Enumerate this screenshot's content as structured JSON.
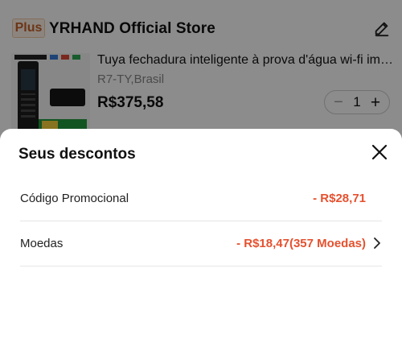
{
  "store": {
    "plus_badge": "Plus",
    "name": "YRHAND Official Store"
  },
  "product": {
    "title": "Tuya fechadura inteligente à prova d'água wi-fi impressão digital",
    "variant": "R7-TY,Brasil",
    "price": "R$375,58",
    "quantity": "1"
  },
  "discounts": {
    "title": "Seus descontos",
    "rows": [
      {
        "label": "Código Promocional",
        "value": "- R$28,71"
      },
      {
        "label": "Moedas",
        "value": "- R$18,47(357 Moedas)"
      }
    ]
  },
  "colors": {
    "accent": "#e5512f",
    "plus_badge": "#c5612a",
    "overlay": "rgba(0,0,0,0.45)"
  },
  "icons": {
    "edit": "pencil-icon",
    "close": "close-icon",
    "chevron": "chevron-right-icon",
    "minus": "minus-icon",
    "plus": "plus-icon"
  }
}
